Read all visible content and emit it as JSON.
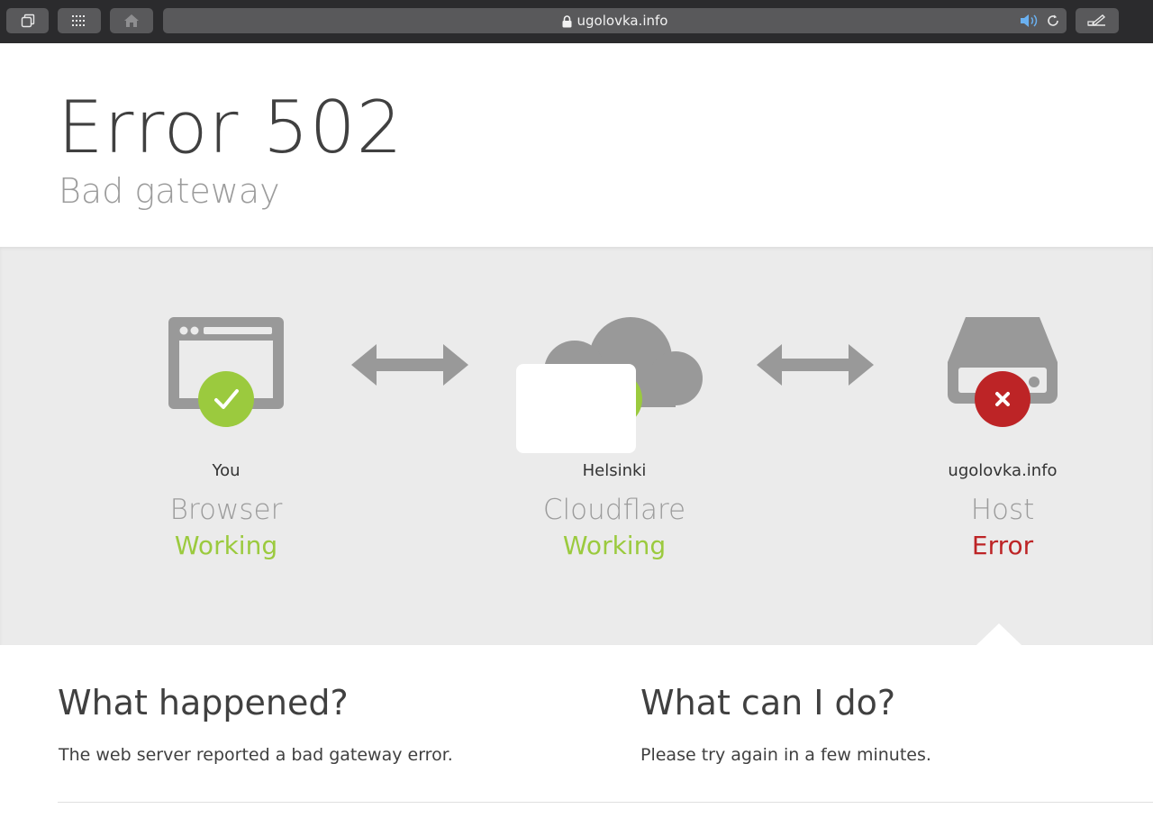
{
  "browser": {
    "url": "ugolovka.info"
  },
  "header": {
    "title": "Error 502",
    "subtitle": "Bad gateway"
  },
  "nodes": [
    {
      "location": "You",
      "name": "Browser",
      "status": "Working",
      "state": "ok"
    },
    {
      "location": "Helsinki",
      "name": "Cloudflare",
      "status": "Working",
      "state": "ok"
    },
    {
      "location": "ugolovka.info",
      "name": "Host",
      "status": "Error",
      "state": "error"
    }
  ],
  "what_happened": {
    "heading": "What happened?",
    "text": "The web server reported a bad gateway error."
  },
  "what_can_i_do": {
    "heading": "What can I do?",
    "text": "Please try again in a few minutes."
  },
  "colors": {
    "ok": "#9bca3e",
    "error": "#bd2426",
    "icon_gray": "#999999",
    "band": "#ebebeb"
  }
}
